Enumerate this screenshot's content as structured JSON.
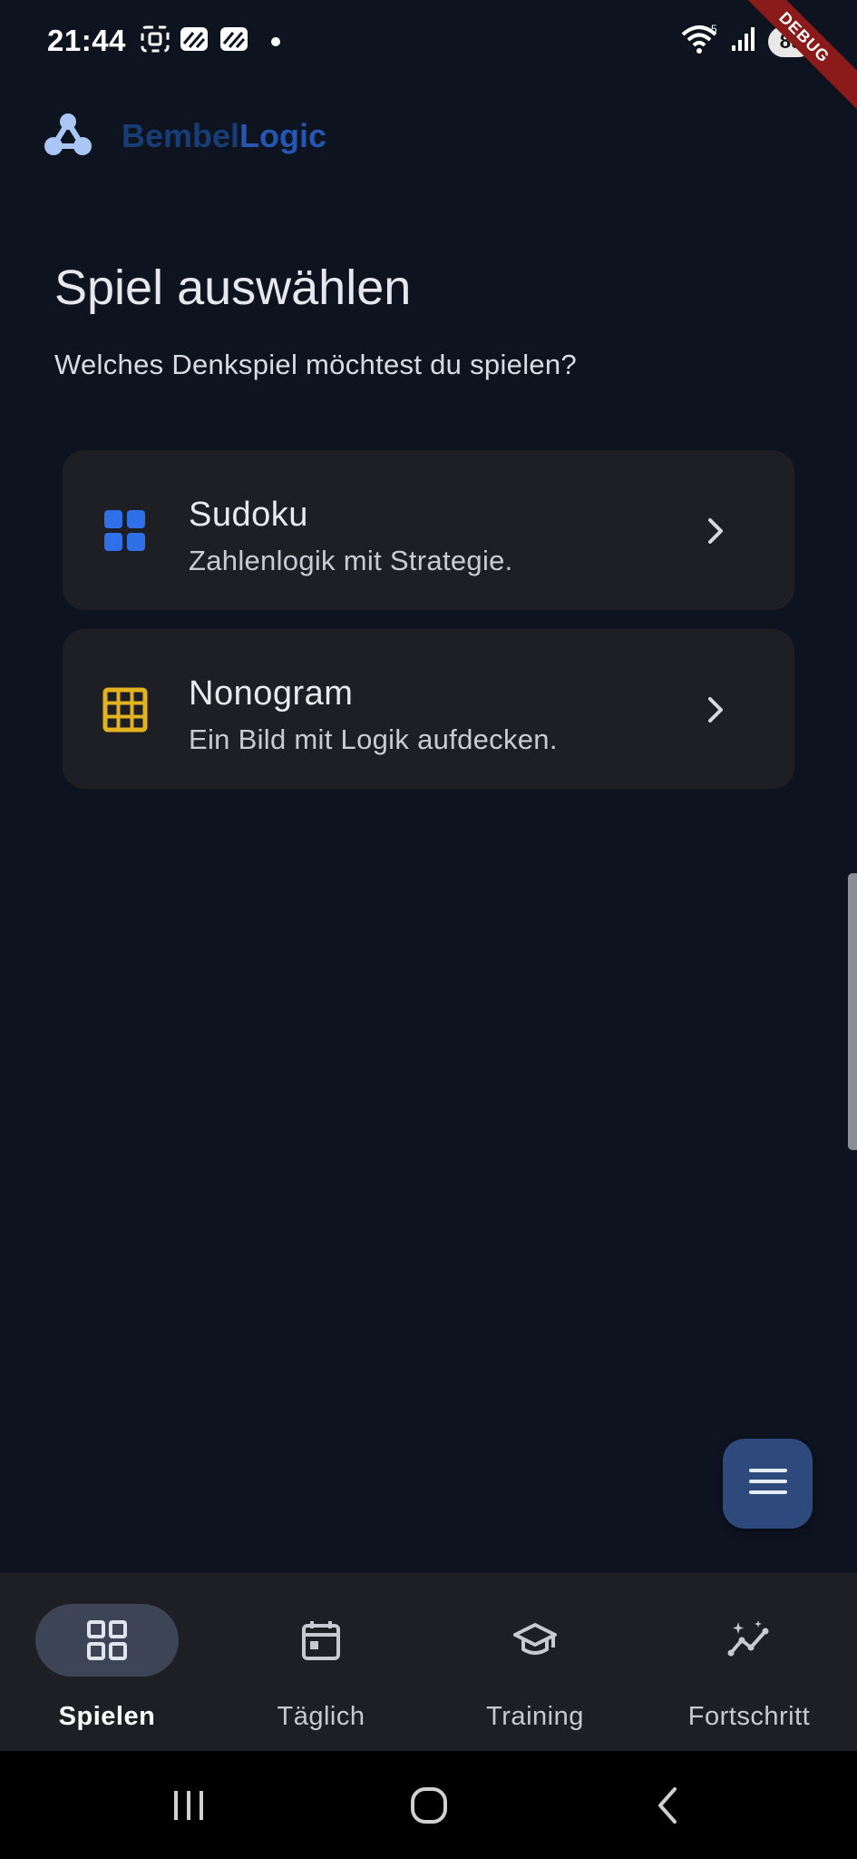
{
  "status_bar": {
    "time": "21:44",
    "battery": "89",
    "network_label": "5",
    "debug_banner": "DEBUG"
  },
  "app": {
    "name_part1": "Bembel",
    "name_part2": "Logic",
    "logo_icon": "molecule-icon",
    "accent": "#2557b2"
  },
  "page": {
    "title": "Spiel auswählen",
    "subtitle": "Welches Denkspiel möchtest du spielen?"
  },
  "games": [
    {
      "title": "Sudoku",
      "description": "Zahlenlogik mit Strategie.",
      "icon": "grid-squares-icon",
      "icon_color": "#2f6fe8"
    },
    {
      "title": "Nonogram",
      "description": "Ein Bild mit Logik aufdecken.",
      "icon": "grid-table-icon",
      "icon_color": "#e3b220"
    }
  ],
  "fab": {
    "icon": "menu-icon"
  },
  "bottom_nav": [
    {
      "label": "Spielen",
      "icon": "apps-grid-icon",
      "active": true
    },
    {
      "label": "Täglich",
      "icon": "calendar-icon",
      "active": false
    },
    {
      "label": "Training",
      "icon": "graduation-cap-icon",
      "active": false
    },
    {
      "label": "Fortschritt",
      "icon": "insights-icon",
      "active": false
    }
  ],
  "system_nav": [
    "recent-apps-icon",
    "home-icon",
    "back-icon"
  ]
}
